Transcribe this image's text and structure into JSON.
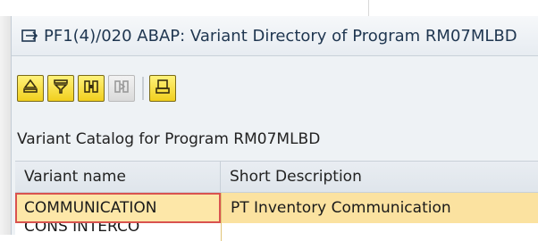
{
  "window": {
    "title": "PF1(4)/020 ABAP: Variant Directory of Program RM07MLBD",
    "title_icon": "sap-window-icon"
  },
  "toolbar": {
    "buttons": [
      {
        "icon": "sort-ascending-icon",
        "enabled": true
      },
      {
        "icon": "filter-icon",
        "enabled": true
      },
      {
        "icon": "find-icon",
        "enabled": true
      },
      {
        "icon": "find-next-icon",
        "enabled": false
      },
      {
        "icon": "print-icon",
        "enabled": true
      }
    ]
  },
  "catalog": {
    "title": "Variant Catalog for Program RM07MLBD"
  },
  "grid": {
    "columns": [
      "Variant name",
      "Short Description"
    ],
    "rows": [
      {
        "variant": "COMMUNICATION",
        "description": "PT Inventory Communication",
        "selected": true
      },
      {
        "variant": "CONS INTERCO",
        "description": "",
        "selected": false
      }
    ]
  },
  "colors": {
    "toolbar_button": "#f1cf1e",
    "selected_row": "#fbe2a0",
    "selected_cell_border": "#d9534f",
    "title_text": "#1f3650"
  }
}
